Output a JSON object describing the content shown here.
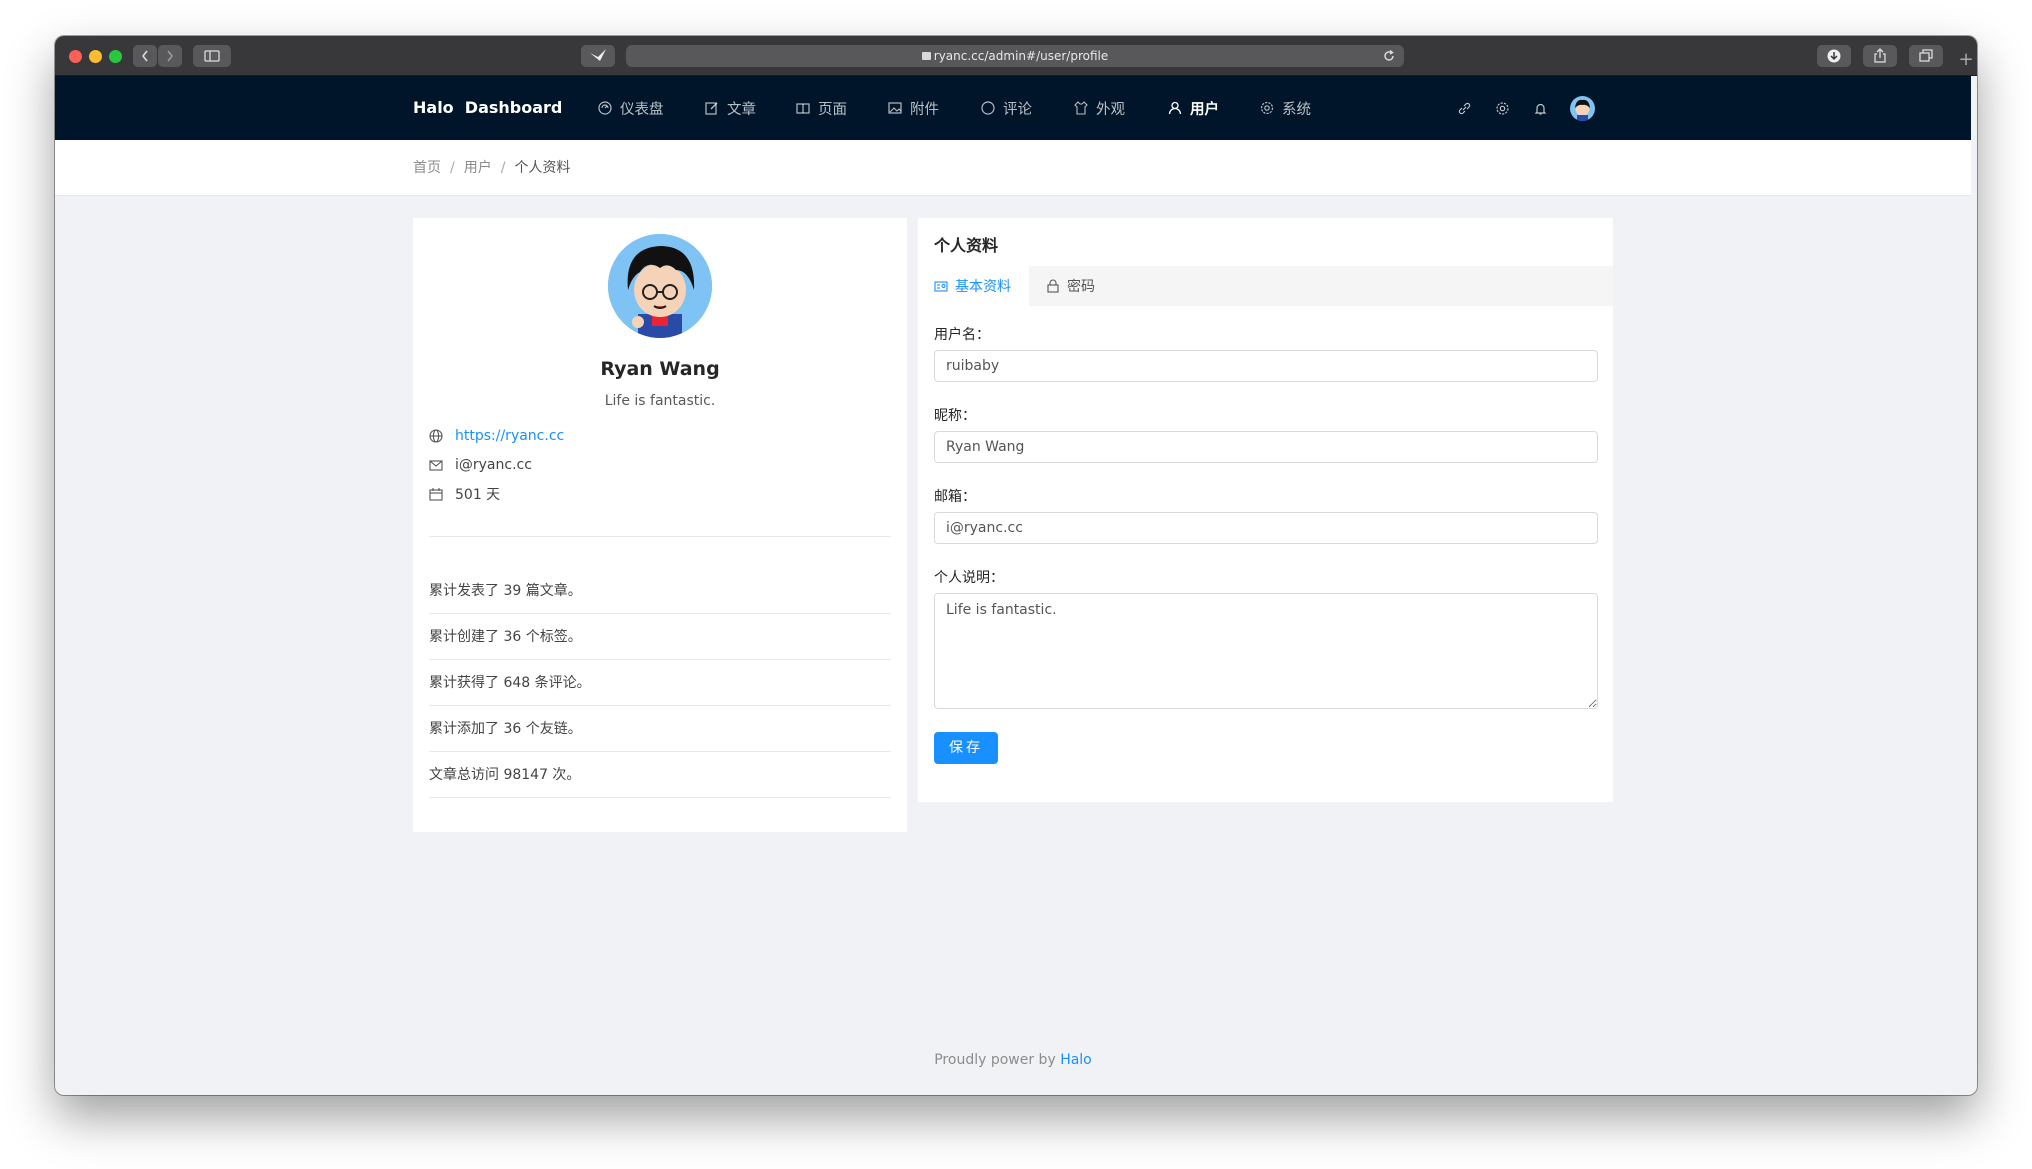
{
  "browser": {
    "url": "ryanc.cc/admin#/user/profile"
  },
  "header": {
    "logo": "Halo  Dashboard",
    "nav": [
      {
        "label": "仪表盘",
        "icon": "dashboard-icon"
      },
      {
        "label": "文章",
        "icon": "edit-icon"
      },
      {
        "label": "页面",
        "icon": "read-icon"
      },
      {
        "label": "附件",
        "icon": "picture-icon"
      },
      {
        "label": "评论",
        "icon": "message-icon"
      },
      {
        "label": "外观",
        "icon": "skin-icon"
      },
      {
        "label": "用户",
        "icon": "user-icon"
      },
      {
        "label": "系统",
        "icon": "setting-icon"
      }
    ],
    "active_nav": "用户"
  },
  "breadcrumb": [
    "首页",
    "用户",
    "个人资料"
  ],
  "profile_card": {
    "name": "Ryan Wang",
    "description": "Life is fantastic.",
    "website": "https://ryanc.cc",
    "email": "i@ryanc.cc",
    "days": "501 天",
    "stats": [
      "累计发表了 39 篇文章。",
      "累计创建了 36 个标签。",
      "累计获得了 648 条评论。",
      "累计添加了 36 个友链。",
      "文章总访问 98147 次。"
    ]
  },
  "form_card": {
    "title": "个人资料",
    "tabs": [
      "基本资料",
      "密码"
    ],
    "active_tab": "基本资料",
    "fields": {
      "username_label": "用户名：",
      "username": "ruibaby",
      "nickname_label": "昵称：",
      "nickname": "Ryan Wang",
      "email_label": "邮箱：",
      "email": "i@ryanc.cc",
      "bio_label": "个人说明：",
      "bio": "Life is fantastic."
    },
    "save_label": "保存"
  },
  "footer": {
    "text": "Proudly power by ",
    "link": "Halo"
  },
  "colors": {
    "header_bg": "#001529",
    "accent": "#1890ff",
    "page_bg": "#f0f2f5"
  }
}
